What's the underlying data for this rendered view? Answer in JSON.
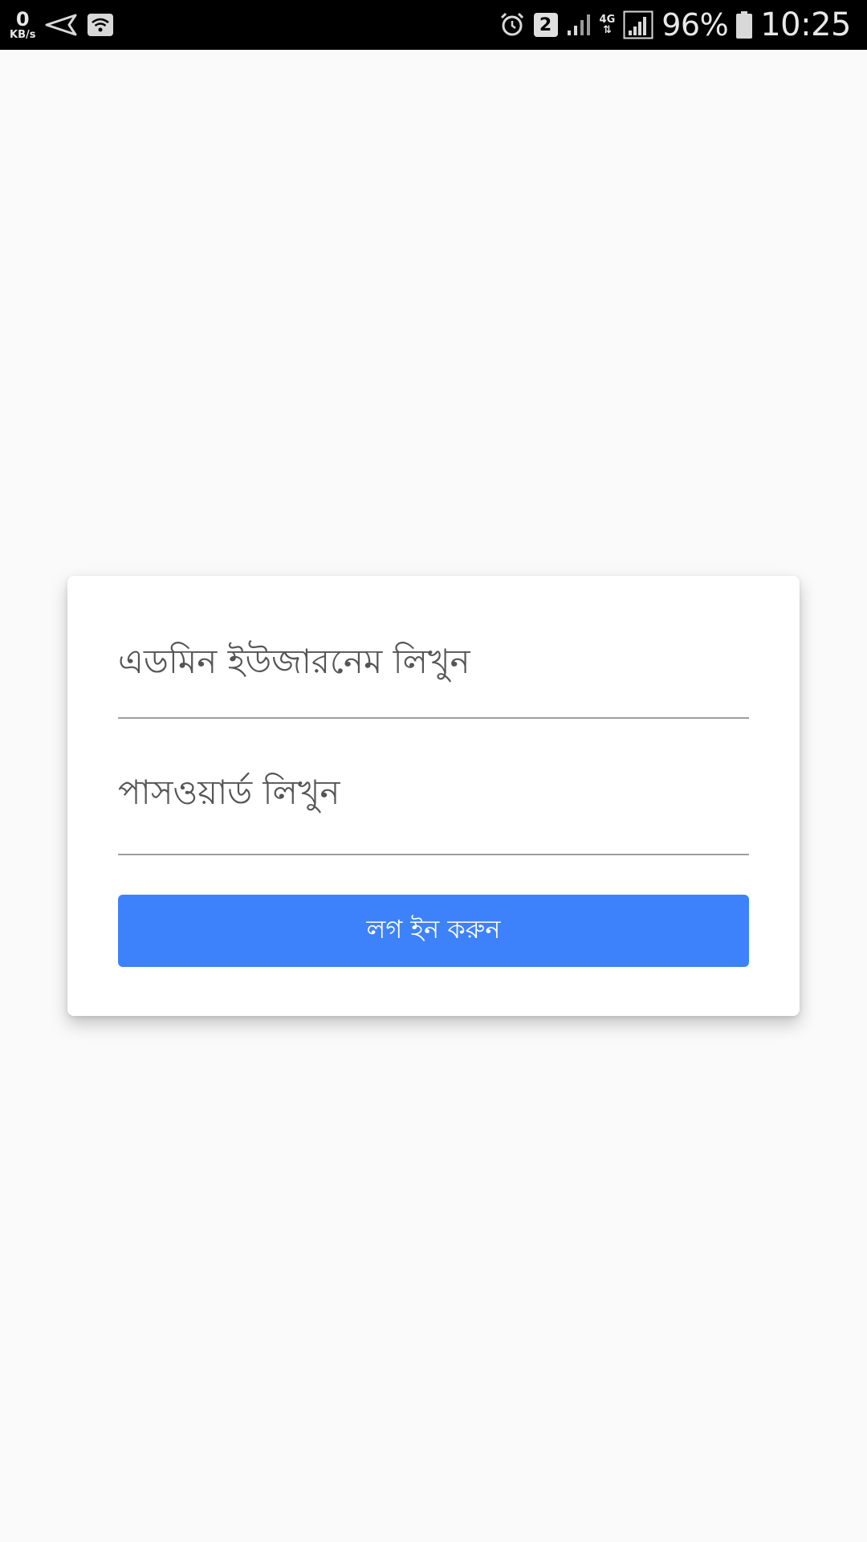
{
  "status_bar": {
    "net_speed_value": "0",
    "net_speed_unit": "KB/s",
    "sim_slot": "2",
    "network_type": "4G",
    "battery_percent": "96%",
    "time": "10:25",
    "icons": [
      "send-icon",
      "wifi-icon",
      "alarm-icon",
      "sim-icon",
      "signal-icon",
      "signal-icon",
      "battery-icon"
    ]
  },
  "login_form": {
    "username_placeholder": "এডমিন ইউজারনেম লিখুন",
    "password_placeholder": "পাসওয়ার্ড লিখুন",
    "login_button_label": "লগ ইন করুন"
  },
  "colors": {
    "accent": "#3d82fb",
    "background": "#fafafa",
    "card": "#ffffff",
    "status_bar": "#000000"
  }
}
